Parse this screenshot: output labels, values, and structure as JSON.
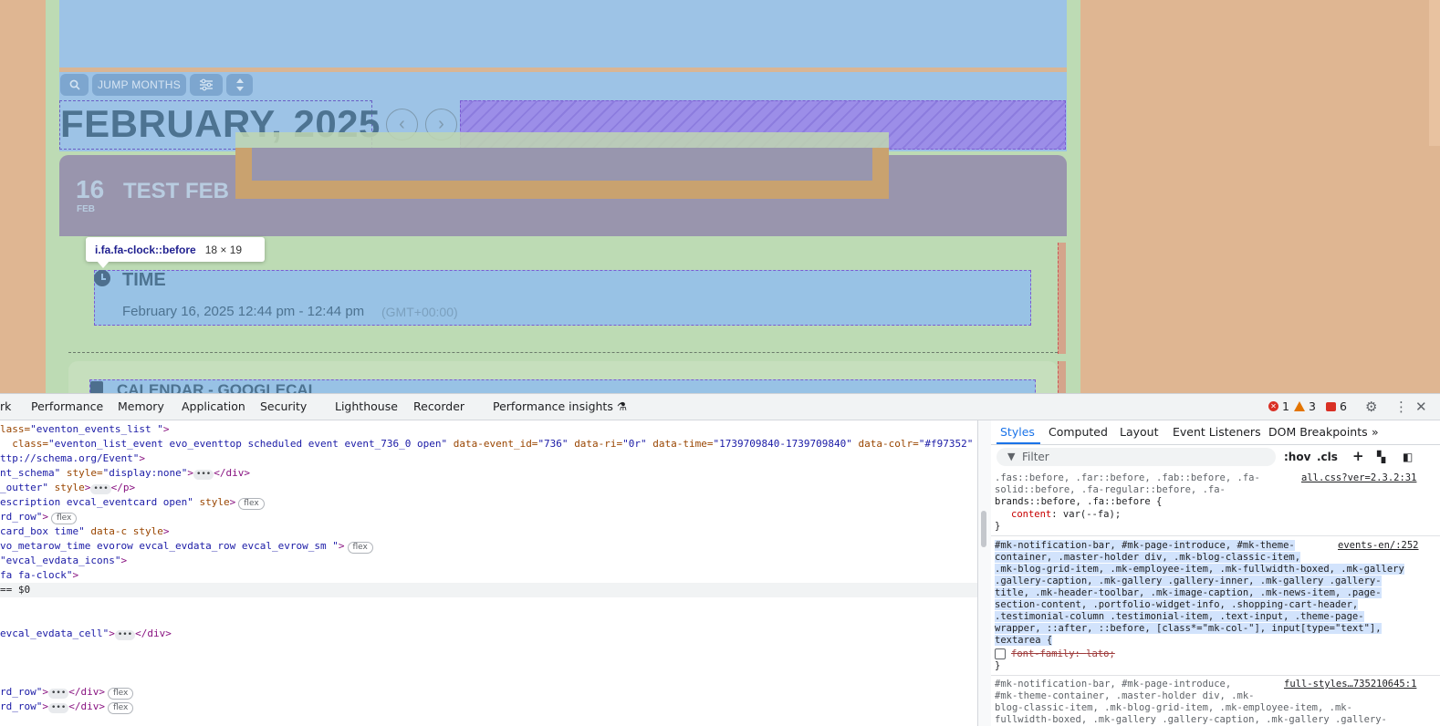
{
  "page": {
    "toolbar": {
      "jump_label": "JUMP MONTHS",
      "search_icon": "search-icon",
      "filter_icon": "sliders-icon",
      "sort_icon": "sort-icon"
    },
    "month_title": "FEBRUARY, 2025",
    "event": {
      "day": "16",
      "month_abbr": "FEB",
      "title": "TEST FEB"
    },
    "tooltip": {
      "selector": "i.fa.fa-clock::before",
      "size": "18 × 19"
    },
    "time": {
      "label": "TIME",
      "value": "February 16, 2025 12:44 pm - 12:44 pm",
      "tz": "(GMT+00:00)"
    },
    "calendar_row": {
      "label": "CALENDAR - GOOGLECAL"
    }
  },
  "devtools": {
    "tabs": [
      "rk",
      "Performance",
      "Memory",
      "Application",
      "Security",
      "Lighthouse",
      "Recorder",
      "Performance insights"
    ],
    "status": {
      "errors": "1",
      "warnings": "3",
      "issues": "6"
    },
    "elements": {
      "l1": {
        "a1": "lass=",
        "v1": "\"eventon_events_list \"",
        "end": ">"
      },
      "l2": {
        "a1": "class=",
        "v1": "\"eventon_list_event evo_eventtop scheduled event event_736_0 open\"",
        "a2": "data-event_id=",
        "v2": "\"736\"",
        "a3": "data-ri=",
        "v3": "\"0r\"",
        "a4": "data-time=",
        "v4": "\"1739709840-1739709840\"",
        "a5": "data-colr=",
        "v5": "\"#f97352\""
      },
      "l3": {
        "v1": "ttp://schema.org/Event\"",
        "end": ">"
      },
      "l4": {
        "v1": "nt_schema\"",
        "a1": "style=",
        "v2": "\"display:none\"",
        "gt": ">",
        "close": "</div>"
      },
      "l5": {
        "v1": "_outter\"",
        "a1": "style",
        "gt": ">",
        "close": "</p>"
      },
      "l6": {
        "v1": "escription evcal_eventcard open\"",
        "a1": "style",
        "gt": ">",
        "badge": "flex"
      },
      "l7": {
        "v1": "rd_row\"",
        "gt": ">",
        "badge": "flex"
      },
      "l8": {
        "v1": "card_box time\"",
        "a1": "data-c",
        "a2": "style",
        "gt": ">"
      },
      "l9": {
        "v1": "vo_metarow_time evorow evcal_evdata_row evcal_evrow_sm \"",
        "gt": ">",
        "badge": "flex"
      },
      "l10": {
        "v1": "\"evcal_evdata_icons\"",
        "gt": ">"
      },
      "l11": {
        "v1": "fa fa-clock\"",
        "gt": ">"
      },
      "l12": {
        "v1": "== $0"
      },
      "l13": {
        "v1": "evcal_evdata_cell\"",
        "gt": ">",
        "close": "</div>"
      },
      "l14": {
        "v1": "rd_row\"",
        "gt": ">",
        "close": "</div>",
        "badge": "flex"
      },
      "l15": {
        "v1": "rd_row\"",
        "gt": ">",
        "close": "</div>",
        "badge": "flex"
      }
    },
    "styles": {
      "tabs": [
        "Styles",
        "Computed",
        "Layout",
        "Event Listeners",
        "DOM Breakpoints"
      ],
      "filter_placeholder": "Filter",
      "hov": ":hov",
      "cls": ".cls",
      "rule1": {
        "lines": [
          ".fas::before, .far::before, .fab::before, .fa-",
          "solid::before, .fa-regular::before, .fa-",
          "brands::before, .fa::before {"
        ],
        "prop": "content",
        "val": "var(--fa);",
        "close": "}",
        "src": "all.css?ver=2.3.2:31"
      },
      "rule2": {
        "lines": [
          "#mk-notification-bar, #mk-page-introduce, #mk-theme-",
          "container, .master-holder div, .mk-blog-classic-item,",
          ".mk-blog-grid-item, .mk-employee-item, .mk-fullwidth-boxed, .mk-gallery",
          ".gallery-caption, .mk-gallery .gallery-inner, .mk-gallery .gallery-",
          "title, .mk-header-toolbar, .mk-image-caption, .mk-news-item, .page-",
          "section-content, .portfolio-widget-info, .shopping-cart-header,",
          ".testimonial-column .testimonial-item, .text-input, .theme-page-",
          "wrapper, ::after, ::before, [class*=\"mk-col-\"], input[type=\"text\"],",
          "textarea {"
        ],
        "prop": "font-family",
        "val": "lato;",
        "close": "}",
        "src": "events-en/:252"
      },
      "rule3": {
        "lines": [
          "#mk-notification-bar, #mk-page-introduce,",
          "#mk-theme-container, .master-holder div, .mk-",
          "blog-classic-item, .mk-blog-grid-item, .mk-employee-item, .mk-",
          "fullwidth-boxed, .mk-gallery .gallery-caption, .mk-gallery .gallery-"
        ],
        "src": "full-styles…735210645:1"
      }
    }
  }
}
